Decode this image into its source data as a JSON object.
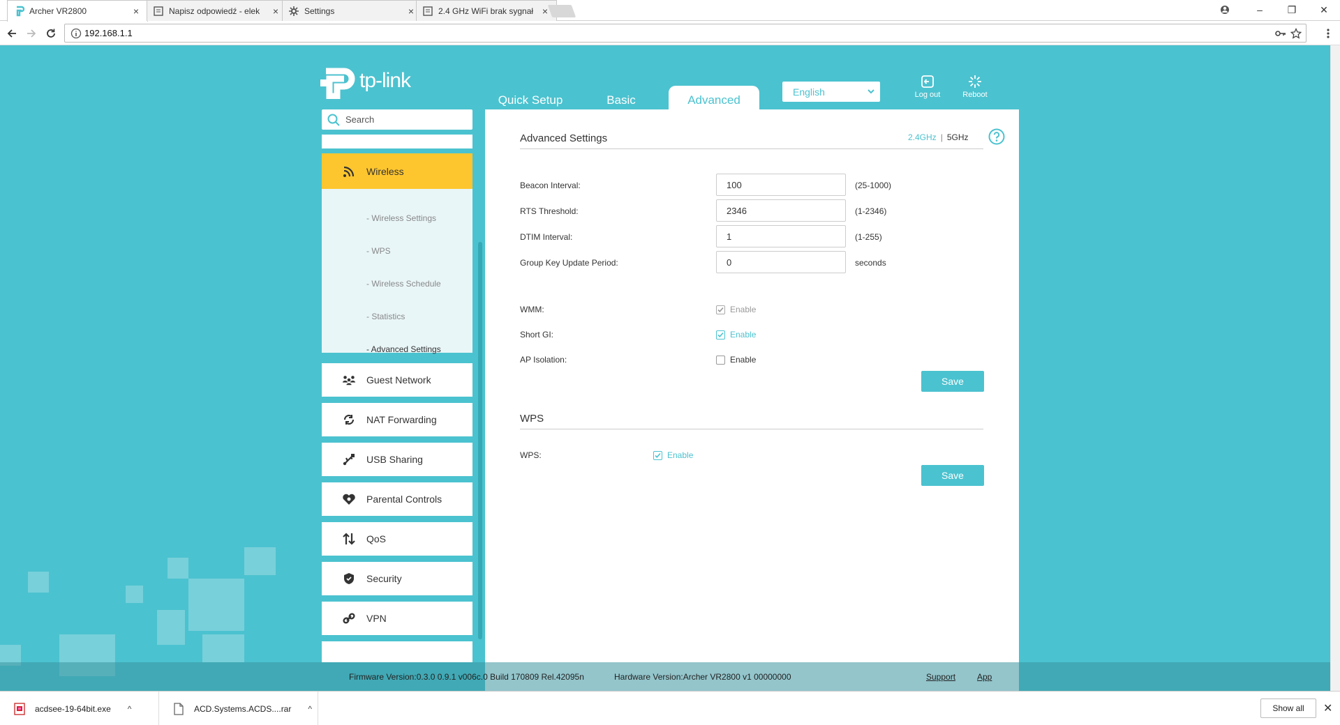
{
  "browser": {
    "tabs": [
      {
        "title": "Archer VR2800",
        "icon": "tplink-icon",
        "active": true
      },
      {
        "title": "Napisz odpowiedź - elek",
        "icon": "document-icon",
        "active": false
      },
      {
        "title": "Settings",
        "icon": "gear-icon",
        "active": false
      },
      {
        "title": "2.4 GHz WiFi brak sygnał",
        "icon": "document-icon",
        "active": false
      }
    ],
    "tab_close": "×",
    "window_controls": {
      "minimize": "–",
      "restore": "❐",
      "close": "✕"
    },
    "url": "192.168.1.1"
  },
  "router": {
    "brand": "tp-link",
    "nav": {
      "quick_setup": "Quick Setup",
      "basic": "Basic",
      "advanced": "Advanced"
    },
    "language": "English",
    "logout": "Log out",
    "reboot": "Reboot",
    "search_placeholder": "Search",
    "sidebar": {
      "wireless": "Wireless",
      "submenu": [
        "- Wireless Settings",
        "- WPS",
        "- Wireless Schedule",
        "- Statistics",
        "- Advanced Settings"
      ],
      "items": [
        "Guest Network",
        "NAT Forwarding",
        "USB Sharing",
        "Parental Controls",
        "QoS",
        "Security",
        "VPN"
      ]
    },
    "content": {
      "title": "Advanced Settings",
      "band_24": "2.4GHz",
      "band_sep": "|",
      "band_5": "5GHz",
      "fields": [
        {
          "label": "Beacon Interval:",
          "value": "100",
          "hint": "(25-1000)"
        },
        {
          "label": "RTS Threshold:",
          "value": "2346",
          "hint": "(1-2346)"
        },
        {
          "label": "DTIM Interval:",
          "value": "1",
          "hint": "(1-255)"
        },
        {
          "label": "Group Key Update Period:",
          "value": "0",
          "hint": "seconds"
        }
      ],
      "checks": [
        {
          "label": "WMM:",
          "text": "Enable",
          "checked": true
        },
        {
          "label": "Short GI:",
          "text": "Enable",
          "checked": true
        },
        {
          "label": "AP Isolation:",
          "text": "Enable",
          "checked": false
        }
      ],
      "save": "Save",
      "wps_title": "WPS",
      "wps_label": "WPS:",
      "wps_enable": "Enable",
      "wps_checked": true
    },
    "footer": {
      "firmware": "Firmware Version:0.3.0 0.9.1 v006c.0 Build 170809 Rel.42095n",
      "hardware": "Hardware Version:Archer VR2800 v1 00000000",
      "support": "Support",
      "app": "App"
    }
  },
  "downloads": {
    "items": [
      {
        "name": "acdsee-19-64bit.exe",
        "icon": "exe-file-icon"
      },
      {
        "name": "ACD.Systems.ACDS....rar",
        "icon": "file-icon"
      }
    ],
    "caret": "^",
    "show_all": "Show all",
    "close": "✕"
  },
  "colors": {
    "accent": "#4bc2cf",
    "active_menu": "#fec62e",
    "submenu_bg": "#e9f6f8"
  }
}
